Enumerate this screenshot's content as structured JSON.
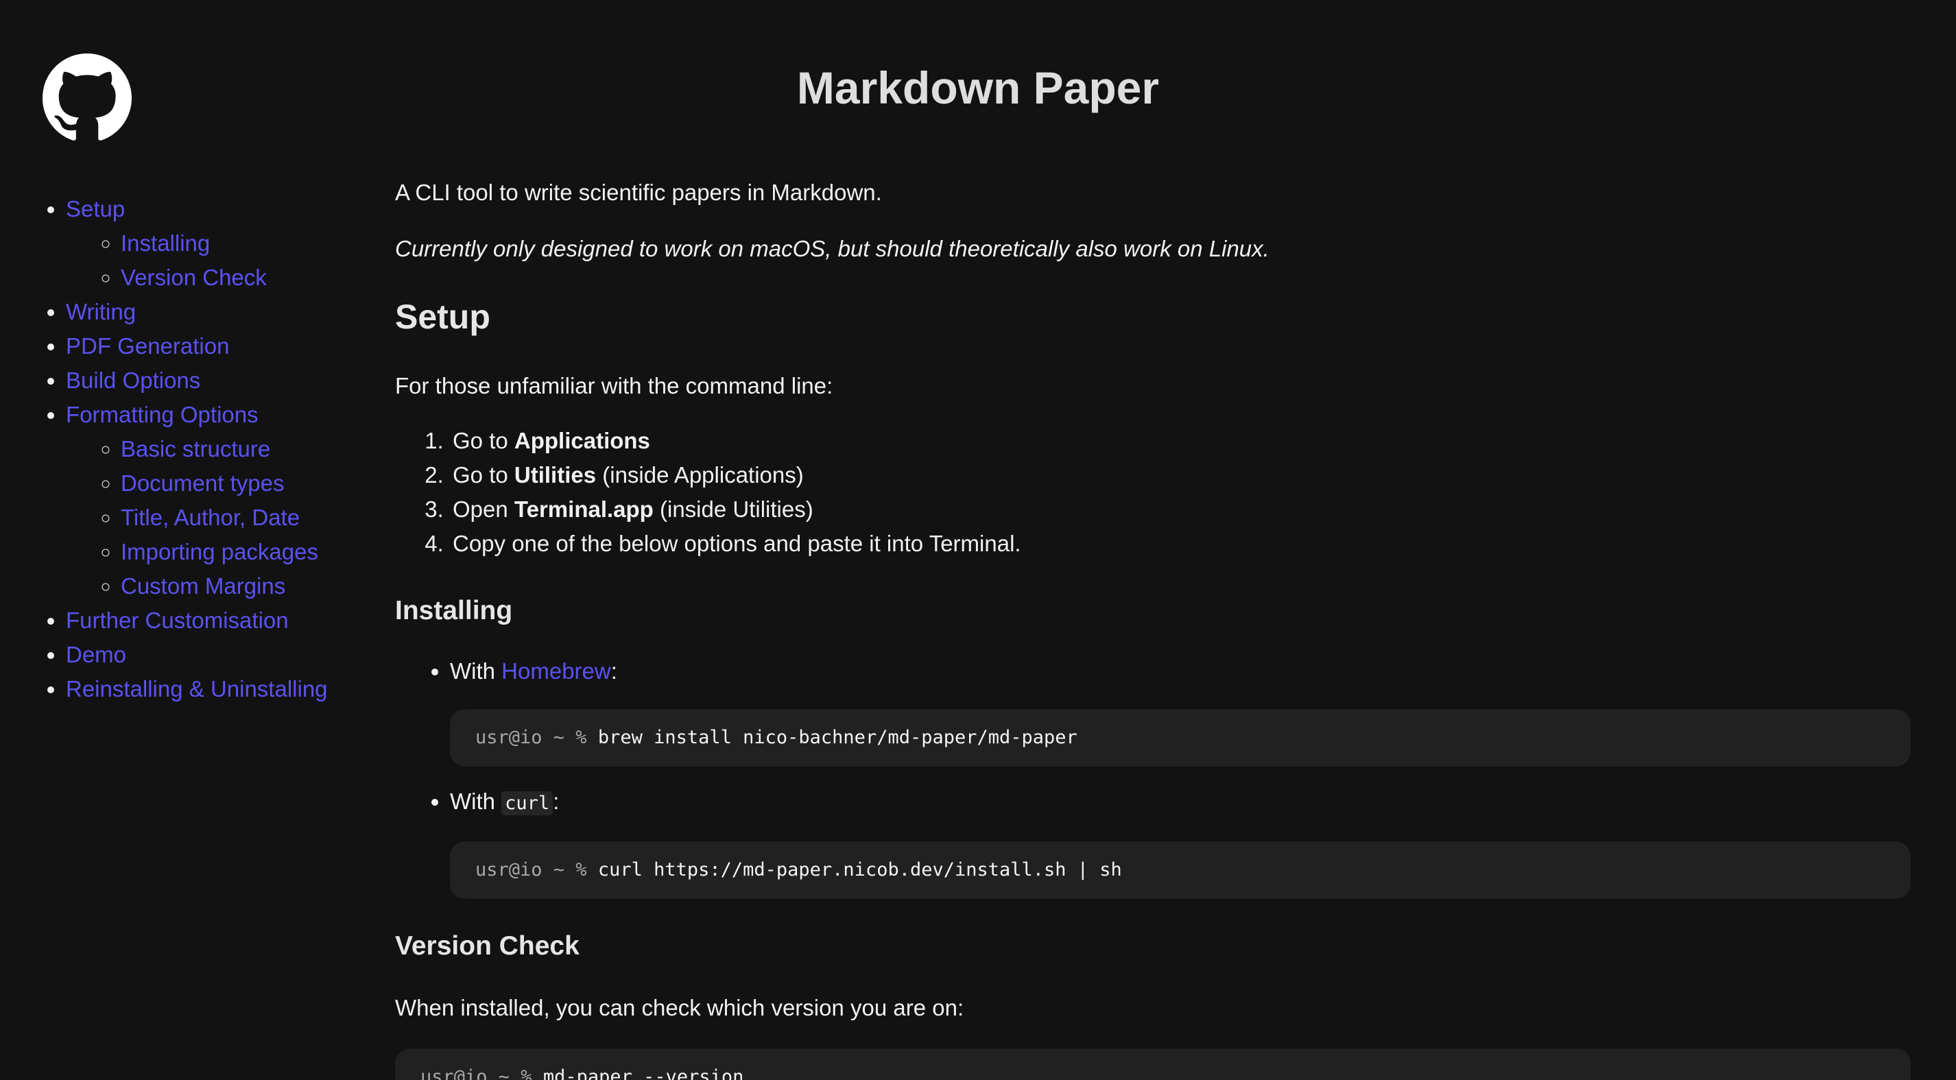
{
  "header": {
    "title": "Markdown Paper"
  },
  "sidebar": {
    "logo_icon": "github-icon",
    "items": [
      {
        "label": "Setup",
        "children": [
          {
            "label": "Installing"
          },
          {
            "label": "Version Check"
          }
        ]
      },
      {
        "label": "Writing"
      },
      {
        "label": "PDF Generation"
      },
      {
        "label": "Build Options"
      },
      {
        "label": "Formatting Options",
        "children": [
          {
            "label": "Basic structure"
          },
          {
            "label": "Document types"
          },
          {
            "label": "Title, Author, Date"
          },
          {
            "label": "Importing packages"
          },
          {
            "label": "Custom Margins"
          }
        ]
      },
      {
        "label": "Further Customisation"
      },
      {
        "label": "Demo"
      },
      {
        "label": "Reinstalling & Uninstalling"
      }
    ]
  },
  "main": {
    "intro": "A CLI tool to write scientific papers in Markdown.",
    "note": "Currently only designed to work on macOS, but should theoretically also work on Linux.",
    "setup": {
      "heading": "Setup",
      "lead": "For those unfamiliar with the command line:",
      "steps": [
        {
          "pre": "Go to ",
          "bold": "Applications",
          "post": ""
        },
        {
          "pre": "Go to ",
          "bold": "Utilities",
          "post": " (inside Applications)"
        },
        {
          "pre": "Open ",
          "bold": "Terminal.app",
          "post": " (inside Utilities)"
        },
        {
          "pre": "Copy one of the below options and paste it into Terminal.",
          "bold": "",
          "post": ""
        }
      ]
    },
    "installing": {
      "heading": "Installing",
      "options": [
        {
          "pre": "With ",
          "link": "Homebrew",
          "post": ":",
          "prompt": "usr@io ~ % ",
          "command": "brew install nico-bachner/md-paper/md-paper"
        },
        {
          "pre": "With ",
          "code": "curl",
          "post": ":",
          "prompt": "usr@io ~ % ",
          "command": "curl https://md-paper.nicob.dev/install.sh | sh"
        }
      ]
    },
    "version_check": {
      "heading": "Version Check",
      "lead": "When installed, you can check which version you are on:",
      "prompt": "usr@io ~ % ",
      "command": "md-paper --version"
    }
  },
  "colors": {
    "background": "#121212",
    "link": "#5b52f0",
    "text": "#f2f2f2",
    "code_background": "#212121"
  }
}
